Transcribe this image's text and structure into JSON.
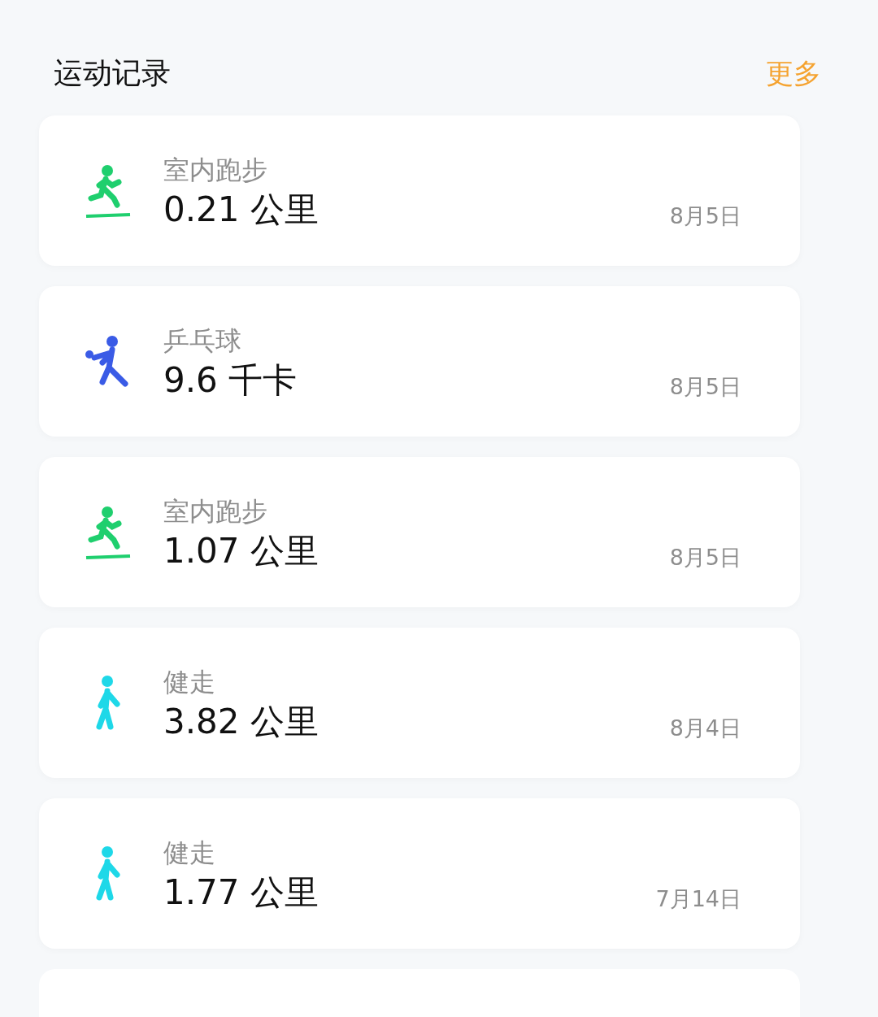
{
  "header": {
    "title": "运动记录",
    "more": "更多"
  },
  "records": [
    {
      "kind": "treadmill",
      "type": "室内跑步",
      "value": "0.21 公里",
      "date": "8月5日"
    },
    {
      "kind": "pingpong",
      "type": "乒乓球",
      "value": "9.6 千卡",
      "date": "8月5日"
    },
    {
      "kind": "treadmill",
      "type": "室内跑步",
      "value": "1.07 公里",
      "date": "8月5日"
    },
    {
      "kind": "walk",
      "type": "健走",
      "value": "3.82 公里",
      "date": "8月4日"
    },
    {
      "kind": "walk",
      "type": "健走",
      "value": "1.77 公里",
      "date": "7月14日"
    }
  ]
}
